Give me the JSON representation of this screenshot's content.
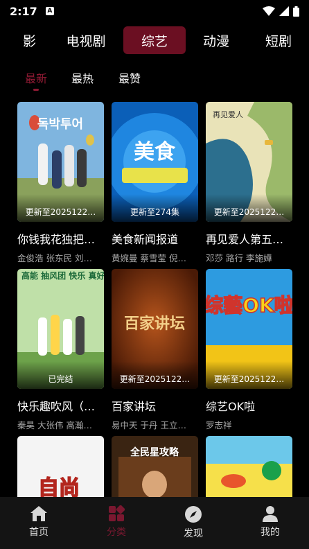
{
  "status": {
    "time": "2:17",
    "notif_letter": "A"
  },
  "tabs": [
    "影",
    "电视剧",
    "综艺",
    "动漫",
    "短剧"
  ],
  "subtabs": [
    "最新",
    "最热",
    "最赞"
  ],
  "cards": [
    {
      "title": "你钱我花独把…",
      "cast": "金俊浩  张东民  刘…",
      "update": "更新至2025122…",
      "poster_text": "독박투어"
    },
    {
      "title": "美食新闻报道",
      "cast": "黄婉曼  蔡雪莹  倪…",
      "update": "更新至274集",
      "poster_text": "美食"
    },
    {
      "title": "再见爱人第五…",
      "cast": "邓莎  路行  李施嬅",
      "update": "更新至2025122…",
      "poster_text": "再见爱人"
    },
    {
      "title": "快乐趣吹风（…",
      "cast": "秦昊  大张伟  高瀚…",
      "update": "已完结",
      "poster_text": "高能 抽风团 快乐 真好笑"
    },
    {
      "title": "百家讲坛",
      "cast": "易中天  于丹  王立…",
      "update": "更新至2025122…",
      "poster_text": "百家讲坛"
    },
    {
      "title": "综艺OK啦",
      "cast": "罗志祥",
      "update": "更新至2025122…",
      "poster_text": "综藝OK啦"
    },
    {
      "title": "",
      "cast": "",
      "update": "",
      "poster_text": "自尚"
    },
    {
      "title": "",
      "cast": "",
      "update": "",
      "poster_text": "全民星攻略"
    },
    {
      "title": "",
      "cast": "",
      "update": "",
      "poster_text": ""
    }
  ],
  "nav": [
    {
      "label": "首页",
      "icon": "home-icon"
    },
    {
      "label": "分类",
      "icon": "category-icon"
    },
    {
      "label": "发现",
      "icon": "compass-icon"
    },
    {
      "label": "我的",
      "icon": "profile-icon"
    }
  ],
  "colors": {
    "accent": "#8e1a33",
    "tab_active_bg": "#6b0f22",
    "background": "#000000"
  }
}
